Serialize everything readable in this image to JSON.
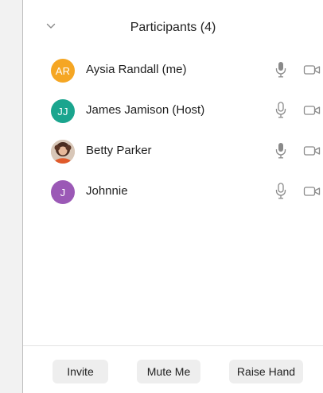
{
  "header": {
    "title": "Participants (4)",
    "collapse_icon": "chevron-down-icon"
  },
  "participants": [
    {
      "initials": "AR",
      "name": "Aysia Randall (me)",
      "avatar_color": "#f5a623",
      "avatar_type": "initials",
      "mic_icon": "microphone-active-icon",
      "camera_icon": "video-camera-icon"
    },
    {
      "initials": "JJ",
      "name": "James Jamison (Host)",
      "avatar_color": "#1aa58e",
      "avatar_type": "initials",
      "mic_icon": "microphone-outline-icon",
      "camera_icon": "video-camera-icon"
    },
    {
      "initials": "",
      "name": "Betty Parker",
      "avatar_color": "#7a4a35",
      "avatar_type": "photo",
      "mic_icon": "microphone-active-icon",
      "camera_icon": "video-camera-icon"
    },
    {
      "initials": "J",
      "name": "Johnnie",
      "avatar_color": "#9b59b6",
      "avatar_type": "initials",
      "mic_icon": "microphone-outline-icon",
      "camera_icon": "video-camera-icon"
    }
  ],
  "footer": {
    "invite_label": "Invite",
    "mute_label": "Mute Me",
    "raise_hand_label": "Raise Hand"
  }
}
